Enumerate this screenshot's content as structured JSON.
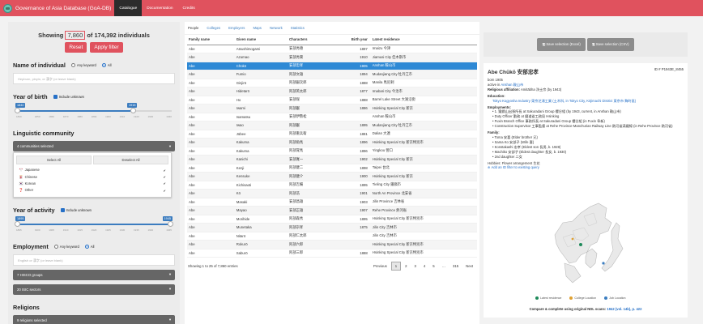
{
  "nav": {
    "title": "Governance of Asia Database (GoA-DB)",
    "links": [
      "Catalogue",
      "Documentation",
      "Credits"
    ]
  },
  "filters": {
    "showing_prefix": "Showing",
    "showing_count": "7,860",
    "showing_suffix": "of 174,392 individuals",
    "reset_label": "Reset",
    "apply_label": "Apply filter",
    "name_title": "Name of individual",
    "any_keyword": "Any keyword",
    "all": "All",
    "name_placeholder": "Hepburn, pinyin, or 漢字 (or leave blank)",
    "birth_title": "Year of birth",
    "include_unknown": "Include unknown",
    "birth_min": "1840",
    "birth_max": "1915",
    "birth_ticks": [
      "1840",
      "1850",
      "1860",
      "1870",
      "1880",
      "1890",
      "1900",
      "1910",
      "1920",
      "1930",
      "1940"
    ],
    "birth_fill": {
      "from": 0,
      "to": 0.75
    },
    "ling_title": "Linguistic community",
    "ling_selected": "4 communities selected",
    "select_all": "Select All",
    "deselect_all": "Deselect All",
    "ling_options": [
      {
        "icon": "🎌",
        "label": "Japanese"
      },
      {
        "icon": "🀄",
        "label": "Chinese"
      },
      {
        "icon": "🇰🇷",
        "label": "Korean"
      },
      {
        "icon": "❓",
        "label": "Other"
      }
    ],
    "activity_title": "Year of activity",
    "activity_unknown": "Include unknown",
    "activity_min": "1895",
    "activity_max": "1945",
    "activity_ticks": [
      "1895",
      "1900",
      "1905",
      "1910",
      "1915",
      "1920",
      "1925",
      "1930",
      "1935",
      "1940",
      "1945"
    ],
    "emp_title": "Employment",
    "emp_placeholder": "English or 漢字 (or leave blank)",
    "hisco": "7 HISCO groups",
    "isic": "20 ISIC sectors",
    "rel_title": "Religions",
    "rel_selected": "9 religions selected"
  },
  "tabs": [
    "People",
    "Colleges",
    "Employers",
    "Maps",
    "Network",
    "Statistics"
  ],
  "table": {
    "headers": [
      "Family name",
      "Given name",
      "Characters",
      "Birth year",
      "Latest residence"
    ],
    "rows": [
      [
        "Abe",
        "Atsushimogami",
        "安部秀德",
        "1897",
        "Imaizu 今津"
      ],
      [
        "Abe",
        "Azumao",
        "安部秀東",
        "1910",
        "Jiamusi City 佳木斯市"
      ],
      [
        "Abe",
        "Chūkō",
        "安部忠孝",
        "1905",
        "Anshan 鞍山市"
      ],
      [
        "Abe",
        "Fumio",
        "阿部文雄",
        "1894",
        "Mudanjiang City 牡丹江市"
      ],
      [
        "Abe",
        "Ginjirō",
        "阿部銀次郎",
        "1888",
        "Manila 馬尼剌"
      ],
      [
        "Abe",
        "Hidetarō",
        "阿部英太郎",
        "1877",
        "Imabari City 今治市"
      ],
      [
        "Abe",
        "Ho",
        "安部保",
        "1888",
        "Barrel Lake Street 大湖沿街"
      ],
      [
        "Abe",
        "Iwami",
        "阿部巌",
        "1886",
        "Hsinking Special City 新京"
      ],
      [
        "Abe",
        "Isamatsu",
        "安部伊勢松",
        "",
        "Anshan 鞍山市"
      ],
      [
        "Abe",
        "Iwao",
        "阿部巌",
        "1895",
        "Mudanjiang City 牡丹江市"
      ],
      [
        "Abe",
        "Jūbee",
        "阿部重兵衛",
        "1881",
        "Dalian 大連"
      ],
      [
        "Abe",
        "Kakuma",
        "阿部角馬",
        "1896",
        "Hsinking Special City 新京特別市"
      ],
      [
        "Abe",
        "Kakuma",
        "阿部覚馬",
        "1896",
        "Yingkou 營口"
      ],
      [
        "Abe",
        "Kanichi",
        "安部寛一",
        "1902",
        "Hsinking Special City 新京"
      ],
      [
        "Abe",
        "Kenji",
        "阿部健二",
        "1898",
        "Taipei 台北"
      ],
      [
        "Abe",
        "Kensuke",
        "阿部健介",
        "1900",
        "Hsinking Special City 新京"
      ],
      [
        "Abe",
        "Kichisaoti",
        "阿部吉備",
        "1895",
        "Tieling City 鐵嶺市"
      ],
      [
        "Abe",
        "Kō",
        "阿部浩",
        "1901",
        "North An Province 北安省"
      ],
      [
        "Abe",
        "Masaki",
        "安部昌雄",
        "1903",
        "Jilin Province 吉林省"
      ],
      [
        "Abe",
        "Mayao",
        "安部正雄",
        "1907",
        "Rehe Province 熱河省"
      ],
      [
        "Abe",
        "Morihide",
        "阿部森秀",
        "1895",
        "Hsinking Special City 新京特別市"
      ],
      [
        "Abe",
        "Munetaka",
        "阿部宗孝",
        "1875",
        "Jilin City 吉林市"
      ],
      [
        "Abe",
        "Nitarō",
        "阿部仁太郎",
        "",
        "Jilin City 吉林市"
      ],
      [
        "Abe",
        "Rokurō",
        "阿部六郎",
        "",
        "Hsinking Special City 新京特別市"
      ],
      [
        "Abe",
        "Saburō",
        "阿部三郎",
        "1888",
        "Hsinking Special City 新京特別市"
      ]
    ],
    "footer": "Showing 1 to 25 of 7,860 entries",
    "pages": [
      "Previous",
      "1",
      "2",
      "3",
      "4",
      "5",
      "…",
      "315",
      "Next"
    ]
  },
  "save": {
    "excel": "Save selection (Excel)",
    "csv": "Save selection (CSV)"
  },
  "detail": {
    "name": "Abe Chūkō 安部忠孝",
    "id": "ID # P1943E_8455",
    "born": "born 1905",
    "active_prefix": "active in",
    "active_place": "Anshan 鞍山市",
    "religion_label": "Religious affiliation:",
    "religion": "Amitābha 淨土宗 (by 1943)",
    "education_label": "Education:",
    "education": "Tokyo Kogyosha Industry 東京芝浦工業 (土木科, in Tokyo City, Kōjimachi District 東京市 麴町區)",
    "employments_label": "Employments:",
    "employments": [
      "1. 鐵鋼山出張所長 at Sakuradani Group 櫻谷組 (by 1943, current, in Anshan 鞍山市)",
      "Duty Officer 勤務 at 鐵道省工務局 Hsinking",
      "Fuxin Branch Office 事務所長 at Sakuradani Group 櫻谷組 (in Fuxin 阜新)",
      "Construction Supervisor 工事監督 at Rehe Province-Manchurian Railway Line 熱河省滿鐵線 (in Rehe Province 熱河省)"
    ],
    "family_label": "Family:",
    "family": [
      "Toma 安喜 (Elder brother 兄)",
      "Sama Ko 安部子 (Wife 妻)",
      "Konstakashi 忠孝 (Eldest son 長男, b. 1928)",
      "Machiko 安部子 (Eldest daughter 長女, b. 1930)",
      "2nd daughter 二女"
    ],
    "hobbies": "Hobbies: Flower arrangement 生花",
    "add_id": "Add an ID filter to existing query",
    "legend": [
      "Latest residence",
      "College Location",
      "Job Location"
    ],
    "compare_prefix": "Compare & complete using original NDL scans:",
    "compare_link": "1942 (vol. 14b), p. 422"
  },
  "colors": {
    "accent": "#e0525e",
    "selected_row": "#2e89d5",
    "link": "#2670c7"
  }
}
